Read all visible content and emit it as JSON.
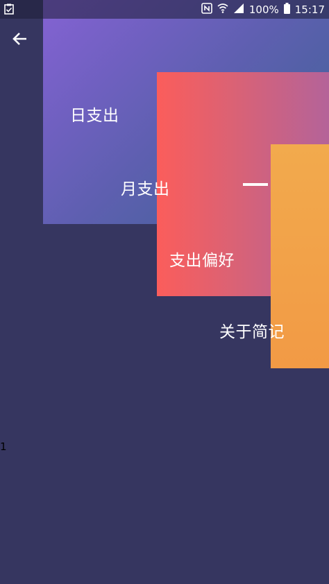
{
  "status_bar": {
    "battery_percent": "100%",
    "time": "15:17",
    "left_icon": "task-check-icon",
    "icons": [
      "nfc-icon",
      "wifi-icon",
      "signal-icon",
      "battery-icon"
    ]
  },
  "nav": {
    "back_icon": "arrow-left-icon"
  },
  "menu": {
    "items": [
      {
        "label": "日支出",
        "color": "#8462d3"
      },
      {
        "label": "月支出",
        "color": "#fb5d5b"
      },
      {
        "label": "支出偏好",
        "color": "#f2aa4d"
      },
      {
        "label": "关于简记",
        "color": "#f29a45"
      }
    ]
  },
  "colors": {
    "background": "#363660",
    "purple_card": "#8462d3",
    "red_card": "#fb5d5b",
    "orange_card": "#f2aa4d"
  },
  "page_indicator": "1"
}
